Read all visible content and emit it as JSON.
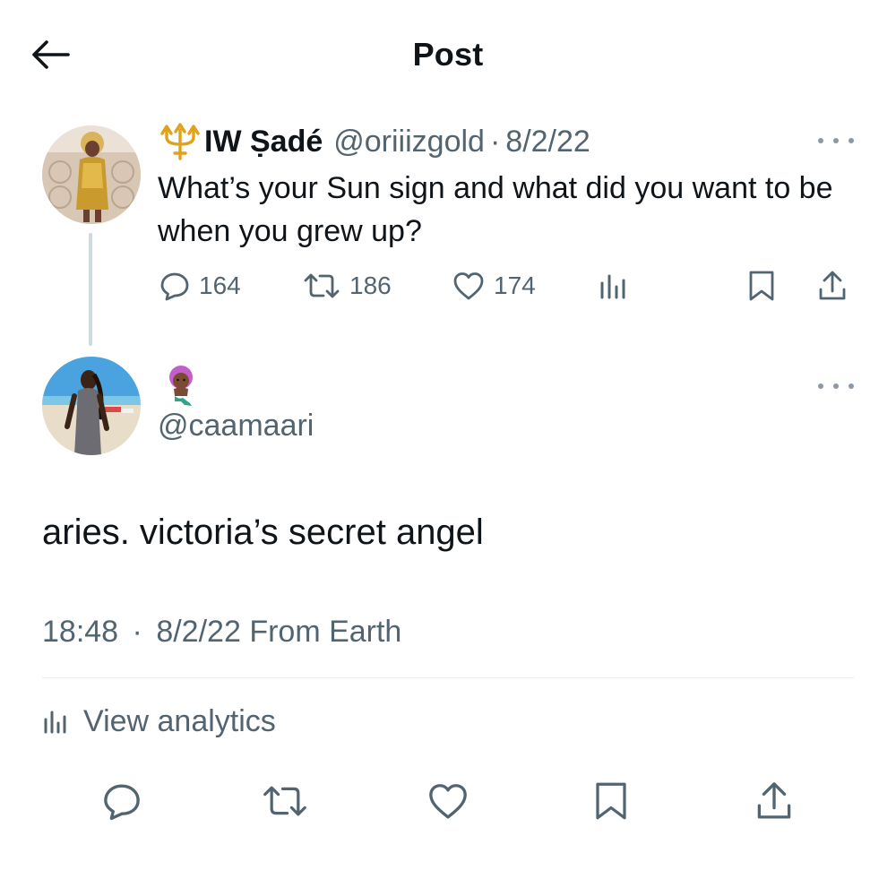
{
  "header": {
    "title": "Post"
  },
  "parent_post": {
    "display_name": "IW Ṣadé",
    "handle": "@oriiizgold",
    "separator": "·",
    "date": "8/2/22",
    "text": "What’s your Sun sign and what did you want to be when you grew up?",
    "stats": {
      "replies": "164",
      "reposts": "186",
      "likes": "174"
    },
    "name_emoji": "trident-icon"
  },
  "reply_post": {
    "emoji": "mermaid-emoji-icon",
    "handle": "@caamaari",
    "text": "aries. victoria’s secret angel",
    "time": "18:48",
    "separator": "·",
    "date": "8/2/22",
    "source": "From Earth",
    "analytics_label": "View analytics"
  },
  "colors": {
    "text": "#0f1419",
    "muted": "#536471",
    "divider": "#e6ecf0",
    "thread_line": "#cfd9de"
  }
}
